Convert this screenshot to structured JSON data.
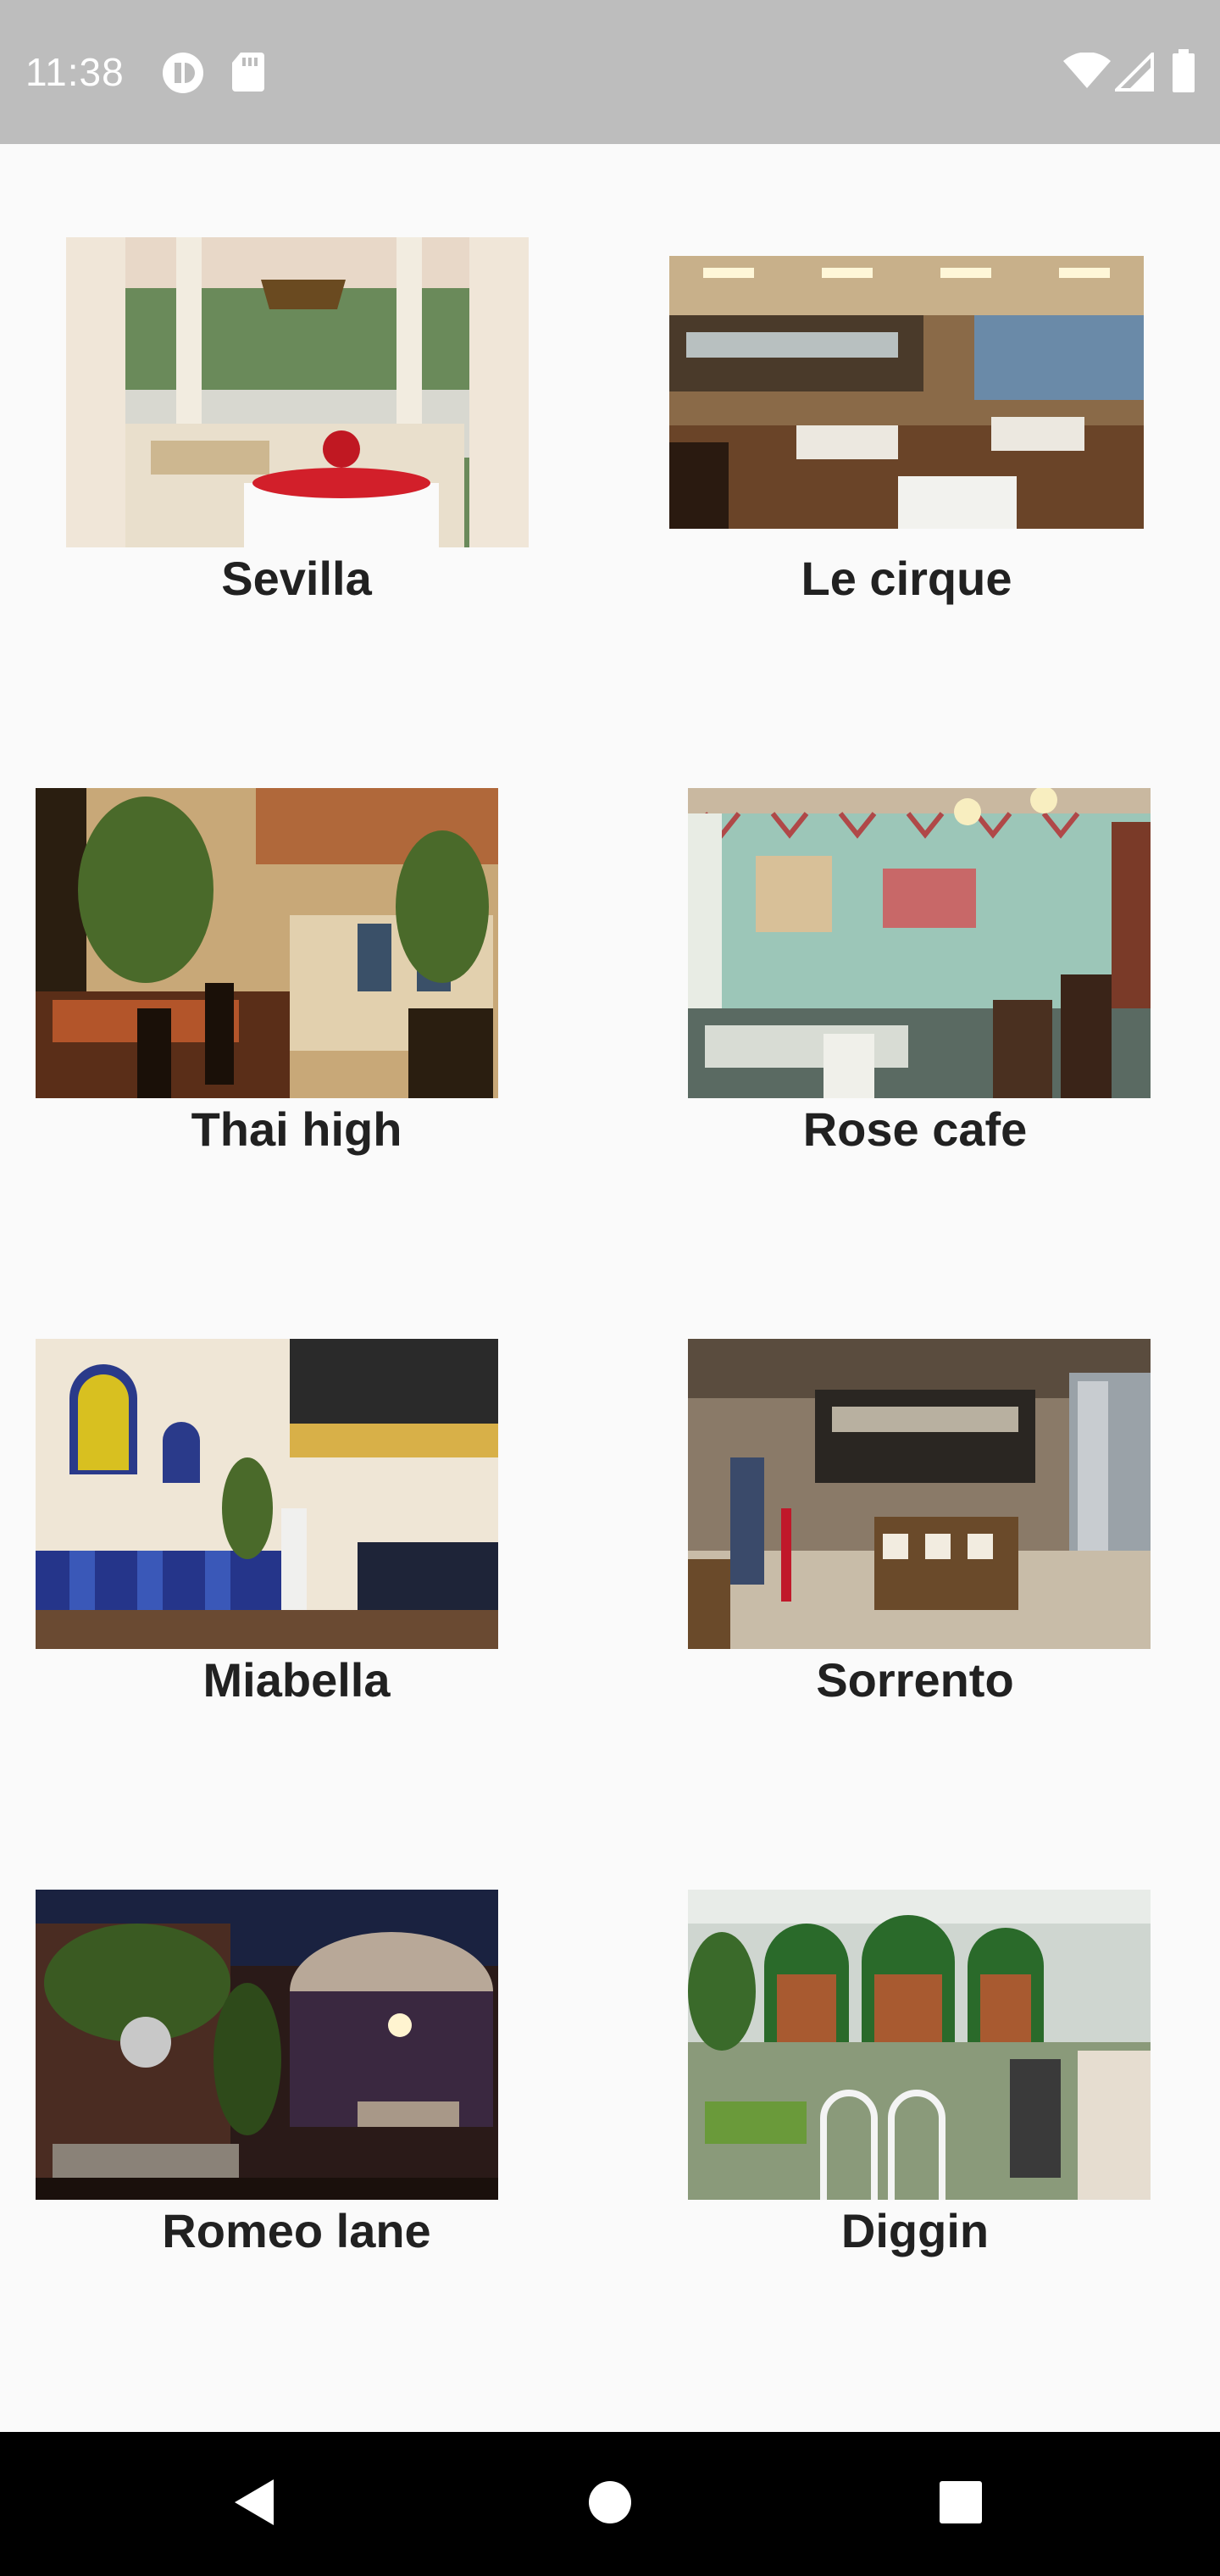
{
  "status_bar": {
    "time": "11:38",
    "icons": [
      "media-app-icon",
      "sd-card-icon",
      "wifi-icon",
      "cellular-signal-icon",
      "battery-icon"
    ]
  },
  "restaurants": [
    {
      "name": "Sevilla",
      "image": "sevilla-photo"
    },
    {
      "name": "Le cirque",
      "image": "le-cirque-photo"
    },
    {
      "name": "Thai high",
      "image": "thai-high-photo"
    },
    {
      "name": "Rose cafe",
      "image": "rose-cafe-photo"
    },
    {
      "name": "Miabella",
      "image": "miabella-photo"
    },
    {
      "name": "Sorrento",
      "image": "sorrento-photo"
    },
    {
      "name": "Romeo lane",
      "image": "romeo-lane-photo"
    },
    {
      "name": "Diggin",
      "image": "diggin-photo"
    }
  ],
  "nav_bar": {
    "icons": [
      "back-icon",
      "home-icon",
      "recents-icon"
    ]
  },
  "colors": {
    "status_bar_bg": "#bdbdbd",
    "page_bg": "#fafafa",
    "nav_bar_bg": "#000000",
    "text": "#212121"
  }
}
